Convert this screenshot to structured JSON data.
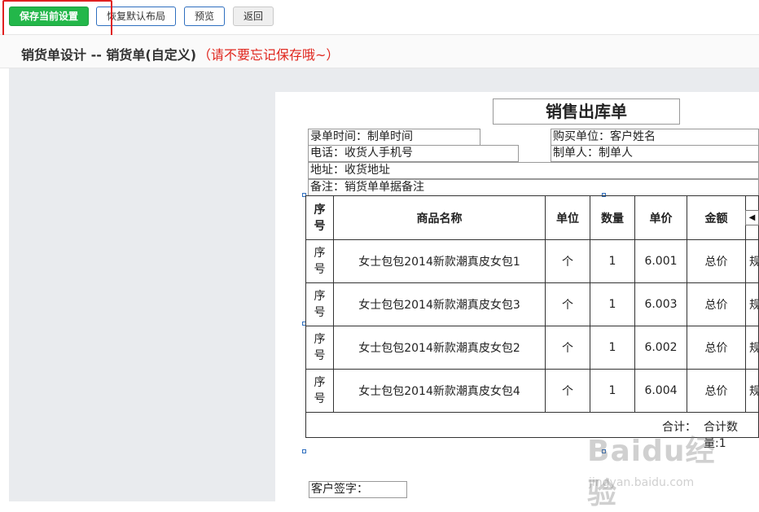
{
  "toolbar": {
    "save_label": "保存当前设置",
    "reset_label": "恢复默认布局",
    "preview_label": "预览",
    "back_label": "返回"
  },
  "header": {
    "title": "销货单设计 -- 销货单(自定义)",
    "note": "（请不要忘记保存哦~）"
  },
  "document": {
    "title": "销售出库单",
    "fields": {
      "entry_time": "录单时间：制单时间",
      "buyer": "购买单位：客户姓名",
      "phone": "电话：收货人手机号",
      "maker": "制单人：制单人",
      "address": "地址：收货地址",
      "remark": "备注：销货单单据备注"
    },
    "table": {
      "headers": [
        "序号",
        "商品名称",
        "单位",
        "数量",
        "单价",
        "金额"
      ],
      "rows": [
        {
          "seq": "序号",
          "name": "女士包包2014新款潮真皮女包1",
          "unit": "个",
          "qty": "1",
          "price": "6.001",
          "amount": "总价",
          "extra": "规"
        },
        {
          "seq": "序号",
          "name": "女士包包2014新款潮真皮女包3",
          "unit": "个",
          "qty": "1",
          "price": "6.003",
          "amount": "总价",
          "extra": "规"
        },
        {
          "seq": "序号",
          "name": "女士包包2014新款潮真皮女包2",
          "unit": "个",
          "qty": "1",
          "price": "6.002",
          "amount": "总价",
          "extra": "规"
        },
        {
          "seq": "序号",
          "name": "女士包包2014新款潮真皮女包4",
          "unit": "个",
          "qty": "1",
          "price": "6.004",
          "amount": "总价",
          "extra": "规"
        }
      ],
      "footer_total": "合计：",
      "footer_qty": "合计数量:1"
    },
    "signature": "客户签字："
  },
  "watermark": {
    "brand": "Baidu经验",
    "url": "jingyan.baidu.com"
  },
  "colors": {
    "save_green": "#23b74a",
    "highlight_red": "#e02020",
    "note_red": "#e0261d",
    "button_border_blue": "#2f6fbf",
    "panel_gray": "#e9ebee"
  }
}
